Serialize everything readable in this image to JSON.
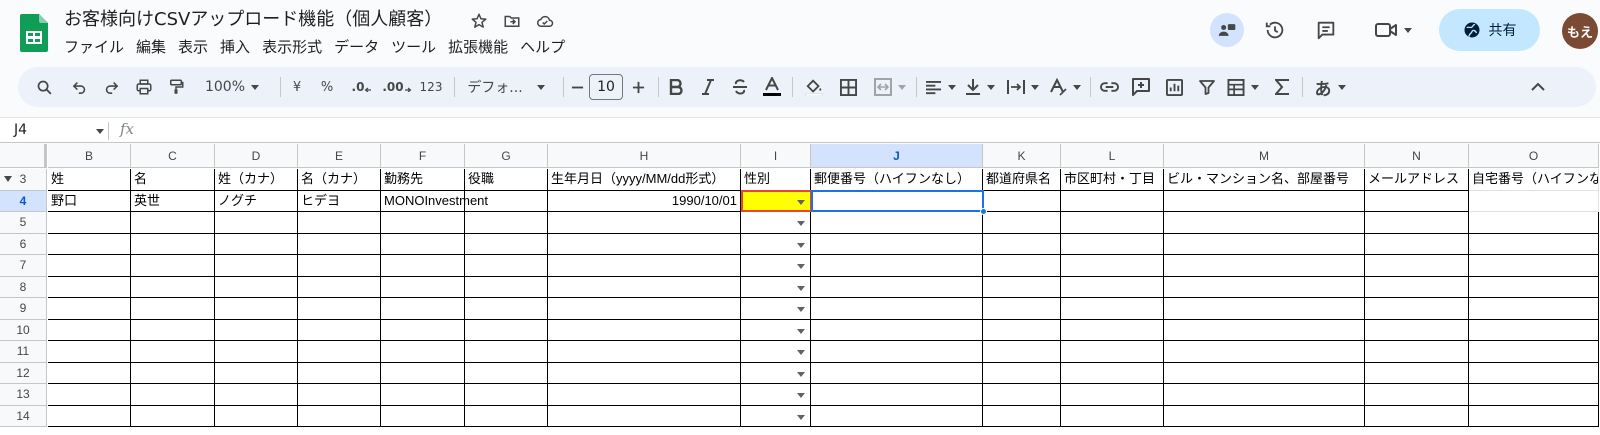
{
  "title": "お客様向けCSVアップロード機能（個人顧客）",
  "menu": [
    "ファイル",
    "編集",
    "表示",
    "挿入",
    "表示形式",
    "データ",
    "ツール",
    "拡張機能",
    "ヘルプ"
  ],
  "header": {
    "share_label": "共有",
    "avatar_text": "もえ",
    "avatar_color": "#7b4a35"
  },
  "toolbar": {
    "zoom": "100%",
    "currency": "¥",
    "percent": "%",
    "dec_decrease": ".0",
    "dec_increase": ".00",
    "number_format": "123",
    "font": "デフォ...",
    "font_size": "10",
    "input_tool": "あ"
  },
  "formula_bar": {
    "cell_ref": "J4",
    "fx": "fx",
    "content": ""
  },
  "grid": {
    "columns": [
      "B",
      "C",
      "D",
      "E",
      "F",
      "G",
      "H",
      "I",
      "J",
      "K",
      "L",
      "M",
      "N",
      "O"
    ],
    "selected_column": "J",
    "row_numbers": [
      "3",
      "4",
      "5",
      "6",
      "7",
      "8",
      "9",
      "10",
      "11",
      "12",
      "13",
      "14"
    ],
    "selected_row": "4",
    "headers": [
      "姓",
      "名",
      "姓（カナ）",
      "名（カナ）",
      "勤務先",
      "役職",
      "生年月日（yyyy/MM/dd形式）",
      "性別",
      "郵便番号（ハイフンなし）",
      "都道府県名",
      "市区町村・丁目",
      "ビル・マンション名、部屋番号",
      "メールアドレス",
      "自宅番号（ハイフンなし）"
    ],
    "data_row": [
      "野口",
      "英世",
      "ノグチ",
      "ヒデヨ",
      "MONOInvestment",
      "",
      "1990/10/01",
      "",
      "",
      "",
      "",
      "",
      "",
      ""
    ],
    "highlight_color": "#ffff00",
    "selection_color": "#1a73e8"
  }
}
